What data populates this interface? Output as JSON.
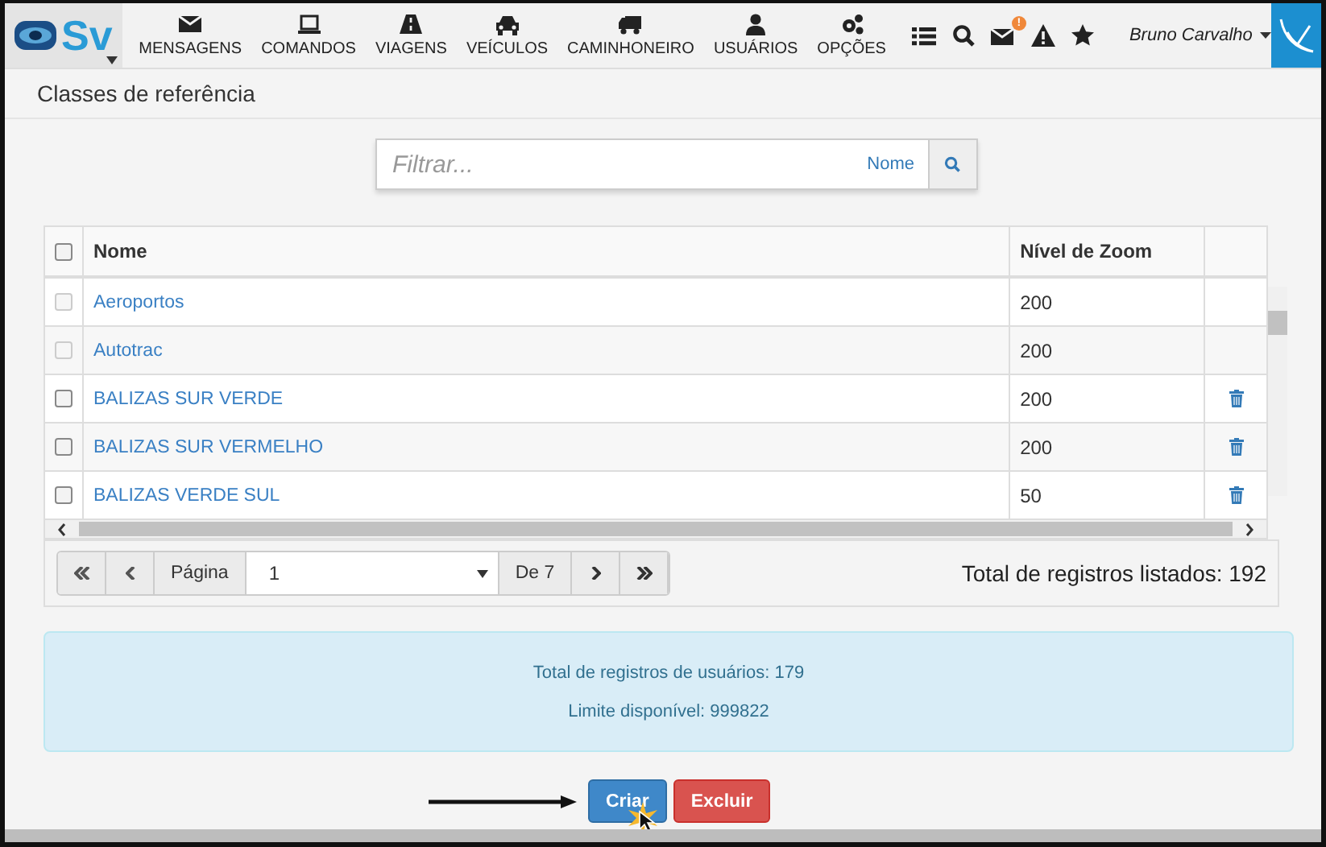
{
  "app": {
    "logo_text": "Sv"
  },
  "nav": [
    {
      "label": "MENSAGENS"
    },
    {
      "label": "COMANDOS"
    },
    {
      "label": "VIAGENS"
    },
    {
      "label": "VEÍCULOS"
    },
    {
      "label": "CAMINHONEIRO"
    },
    {
      "label": "USUÁRIOS"
    },
    {
      "label": "OPÇÕES"
    }
  ],
  "toolbar": {
    "message_badge": "!"
  },
  "user": {
    "name": "Bruno Carvalho"
  },
  "page": {
    "title": "Classes de referência"
  },
  "filter": {
    "placeholder": "Filtrar...",
    "field": "Nome"
  },
  "table": {
    "select_all_checked": false,
    "columns": [
      "Nome",
      "Nível de Zoom"
    ],
    "rows": [
      {
        "name": "Aeroportos",
        "zoom": "200",
        "disabled": true,
        "deletable": false
      },
      {
        "name": "Autotrac",
        "zoom": "200",
        "disabled": true,
        "deletable": false
      },
      {
        "name": "BALIZAS SUR VERDE",
        "zoom": "200",
        "disabled": false,
        "deletable": true
      },
      {
        "name": "BALIZAS SUR VERMELHO",
        "zoom": "200",
        "disabled": false,
        "deletable": true
      },
      {
        "name": "BALIZAS VERDE SUL",
        "zoom": "50",
        "disabled": false,
        "deletable": true
      }
    ]
  },
  "pagination": {
    "page_label": "Página",
    "page": "1",
    "of": "De 7",
    "total": "Total de registros listados: 192"
  },
  "info": {
    "lines": [
      "Total de registros de usuários: 179",
      "Limite disponível: 999822"
    ]
  },
  "buttons": [
    {
      "label": "Criar",
      "kind": "primary"
    },
    {
      "label": "Excluir",
      "kind": "danger"
    }
  ]
}
